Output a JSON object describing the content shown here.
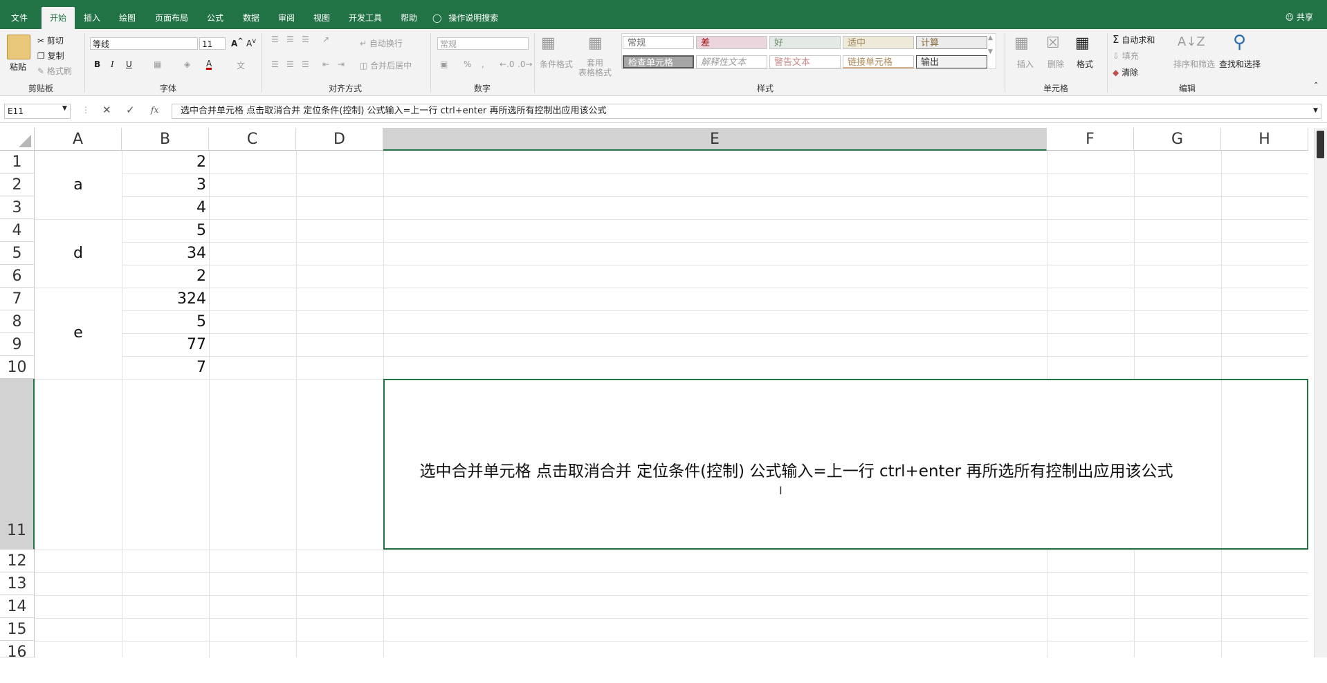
{
  "ribbon_tabs": [
    "文件",
    "开始",
    "插入",
    "绘图",
    "页面布局",
    "公式",
    "数据",
    "审阅",
    "视图",
    "开发工具",
    "帮助"
  ],
  "search_hint": "操作说明搜索",
  "share": "共享",
  "clipboard": {
    "paste": "粘贴",
    "cut": "剪切",
    "copy": "复制",
    "format_painter": "格式刷",
    "group": "剪贴板"
  },
  "font": {
    "name": "等线",
    "size": "11",
    "group": "字体"
  },
  "alignment": {
    "wrap": "自动换行",
    "merge": "合并后居中",
    "group": "对齐方式"
  },
  "number": {
    "format": "常规",
    "group": "数字"
  },
  "styles": {
    "cond_format": "条件格式",
    "table_format": "套用\n表格格式",
    "row1": [
      "常规",
      "差",
      "好",
      "适中",
      "计算"
    ],
    "row2": [
      "检查单元格",
      "解释性文本",
      "警告文本",
      "链接单元格",
      "输出"
    ],
    "group": "样式"
  },
  "cells": {
    "insert": "插入",
    "delete": "删除",
    "format": "格式",
    "group": "单元格"
  },
  "editing": {
    "autosum": "自动求和",
    "fill": "填充",
    "clear": "清除",
    "sort": "排序和筛选",
    "find": "查找和选择",
    "group": "编辑"
  },
  "formula_bar": {
    "name_box": "E11",
    "fx": "fx",
    "content": "选中合并单元格 点击取消合并 定位条件(控制) 公式输入=上一行 ctrl+enter 再所选所有控制出应用该公式"
  },
  "columns": [
    "A",
    "B",
    "C",
    "D",
    "E",
    "F",
    "G",
    "H"
  ],
  "rows": [
    "1",
    "2",
    "3",
    "4",
    "5",
    "6",
    "7",
    "8",
    "9",
    "10",
    "11",
    "12",
    "13",
    "14",
    "15",
    "16"
  ],
  "merged_a": [
    "a",
    "d",
    "e"
  ],
  "col_b": [
    "2",
    "3",
    "4",
    "5",
    "34",
    "2",
    "324",
    "5",
    "77",
    "7"
  ],
  "e11_text": "选中合并单元格 点击取消合并 定位条件(控制) 公式输入=上一行 ctrl+enter 再所选所有控制出应用该公式"
}
